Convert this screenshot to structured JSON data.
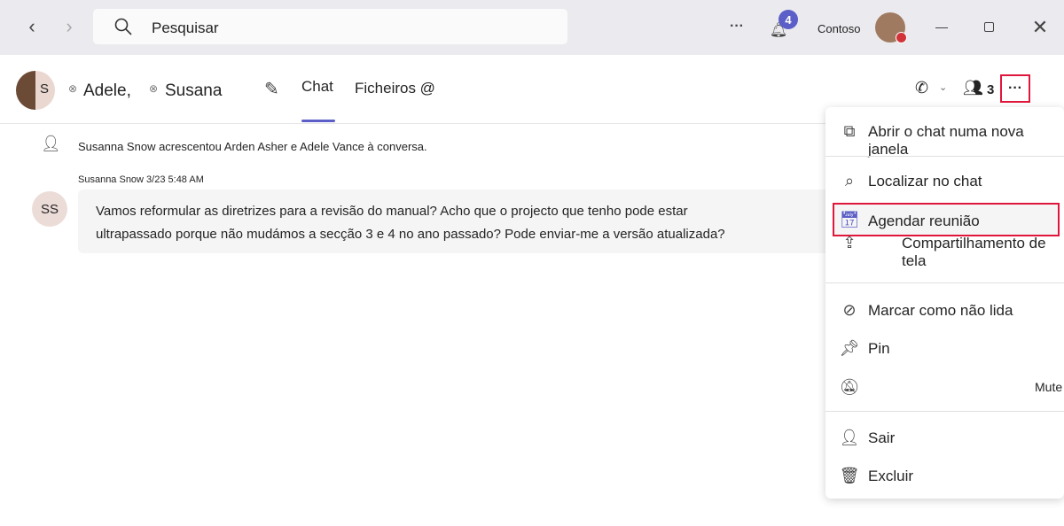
{
  "titlebar": {
    "search_placeholder": "Pesquisar",
    "notification_count": "4",
    "org": "Contoso"
  },
  "header": {
    "participants": [
      "Adele,",
      "Susana"
    ],
    "avatar_initial": "S",
    "tabs": [
      "Chat",
      "Ficheiros @"
    ],
    "people_count": "3"
  },
  "chat": {
    "system_message": "Susanna Snow acrescentou Arden Asher e Adele Vance à conversa.",
    "message": {
      "author_time": "Susanna Snow 3/23 5:48 AM",
      "initials": "SS",
      "lines": [
        "Vamos reformular as diretrizes para a revisão do manual? Acho que o projecto que tenho pode estar",
        "ultrapassado porque não mudámos a secção 3 e 4 no ano passado? Pode enviar-me a versão atualizada?"
      ]
    }
  },
  "menu": {
    "items": [
      "Abrir o chat numa nova janela",
      "Localizar no chat",
      "Agendar reunião",
      "Compartilhamento de tela",
      "Marcar como não lida",
      "Pin",
      "Mute",
      "Sair",
      "Excluir"
    ]
  },
  "colors": {
    "accent": "#5b5fc7",
    "highlight": "#e0173c"
  }
}
